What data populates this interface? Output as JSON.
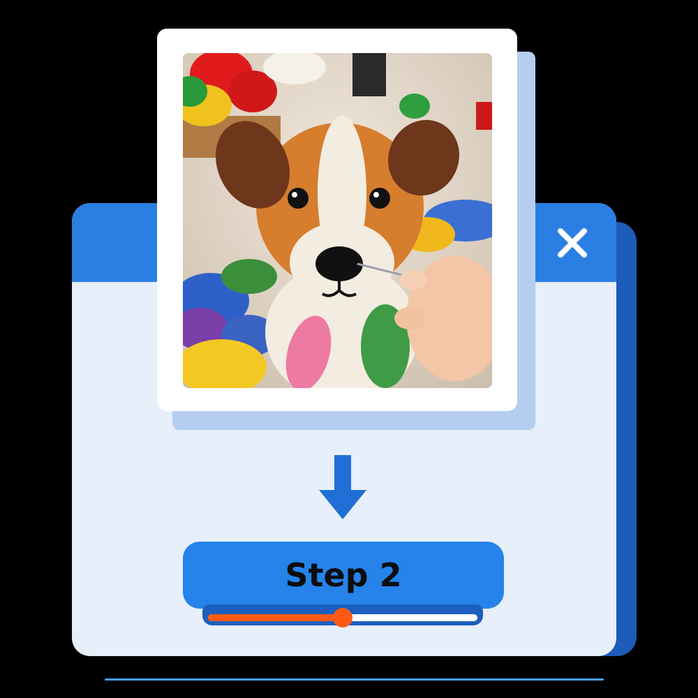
{
  "window": {
    "close_icon": "close-x-icon",
    "accent_color": "#2b7fe3",
    "body_color": "#e6effa"
  },
  "photo": {
    "subject": "felted-dog-photo",
    "icon": "photo-image"
  },
  "arrow": {
    "icon": "arrow-down-icon",
    "color": "#1f6fd6"
  },
  "step": {
    "label": "Step 2"
  },
  "progress": {
    "value": 0.5,
    "fill_color": "#ff5a14"
  }
}
